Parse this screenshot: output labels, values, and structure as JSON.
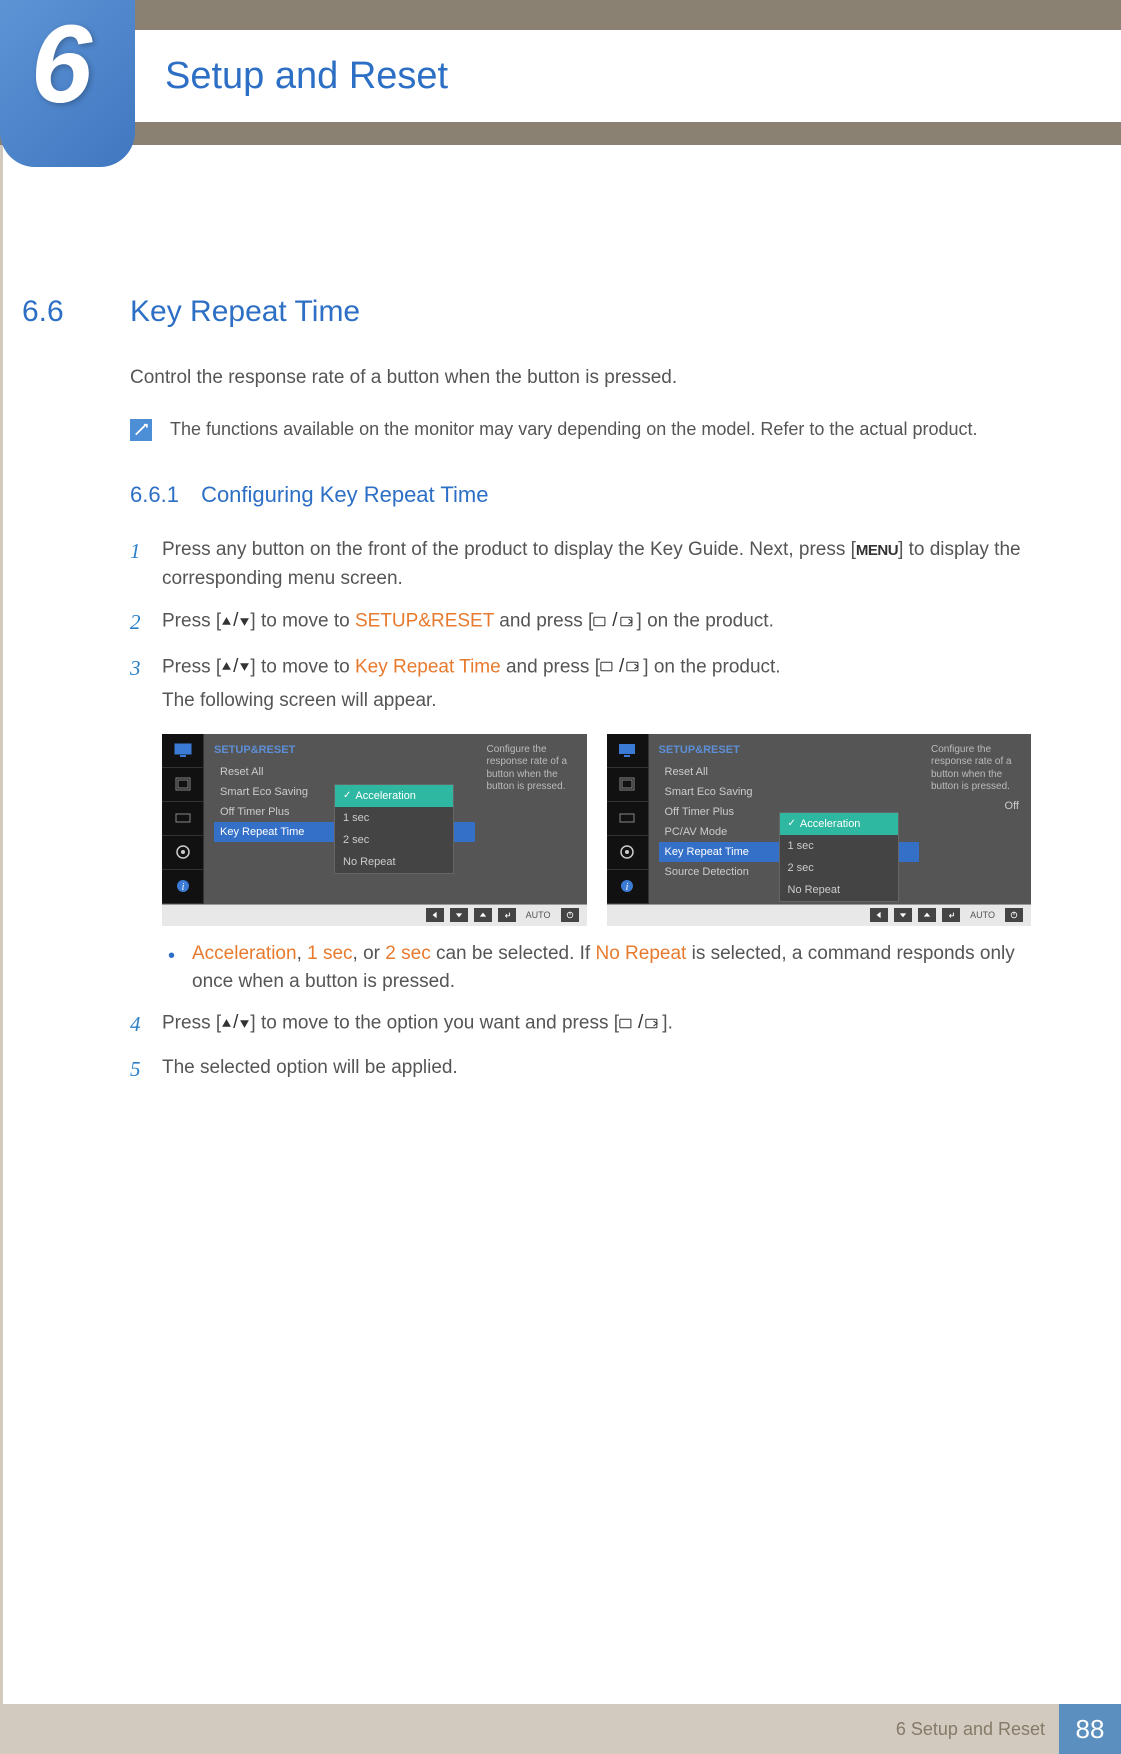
{
  "chapter": {
    "number": "6",
    "title": "Setup and Reset"
  },
  "section": {
    "number": "6.6",
    "title": "Key Repeat Time",
    "intro": "Control the response rate of a button when the button is pressed.",
    "note": "The functions available on the monitor may vary depending on the model. Refer to the actual product."
  },
  "subsection": {
    "number": "6.6.1",
    "title": "Configuring Key Repeat Time"
  },
  "steps": {
    "s1a": "Press any button on the front of the product to display the Key Guide. Next, press [",
    "s1_menu": "MENU",
    "s1b": "] to display the corresponding menu screen.",
    "s2a": "Press [",
    "s2b": "] to move to ",
    "s2_target": "SETUP&RESET",
    "s2c": " and press [",
    "s2d": "] on the product.",
    "s3a": "Press [",
    "s3b": "] to move to ",
    "s3_target": "Key Repeat Time",
    "s3c": " and press [",
    "s3d": "] on the product.",
    "s3_sub": "The following screen will appear.",
    "bullet_a": "Acceleration",
    "bullet_comma1": ", ",
    "bullet_b": "1 sec",
    "bullet_comma2": ", or ",
    "bullet_c": "2 sec",
    "bullet_mid": " can be selected. If ",
    "bullet_d": "No Repeat",
    "bullet_end": " is selected, a command responds only once when a button is pressed.",
    "s4a": "Press [",
    "s4b": "] to move to the option you want and press [",
    "s4c": "].",
    "s5": "The selected option will be applied."
  },
  "step_nums": {
    "n1": "1",
    "n2": "2",
    "n3": "3",
    "n4": "4",
    "n5": "5"
  },
  "osd": {
    "header": "SETUP&RESET",
    "help": "Configure the response rate of a button when the button is pressed.",
    "auto": "AUTO",
    "off": "Off",
    "menu1": {
      "items": [
        "Reset All",
        "Smart Eco Saving",
        "Off Timer Plus",
        "Key Repeat Time"
      ],
      "selected": "Key Repeat Time"
    },
    "menu2": {
      "items": [
        "Reset All",
        "Smart Eco Saving",
        "Off Timer Plus",
        "PC/AV Mode",
        "Key Repeat Time",
        "Source Detection"
      ],
      "selected": "Key Repeat Time"
    },
    "popup": {
      "items": [
        "Acceleration",
        "1 sec",
        "2 sec",
        "No Repeat"
      ],
      "selected": "Acceleration"
    }
  },
  "footer": {
    "text": "6 Setup and Reset",
    "page": "88"
  }
}
